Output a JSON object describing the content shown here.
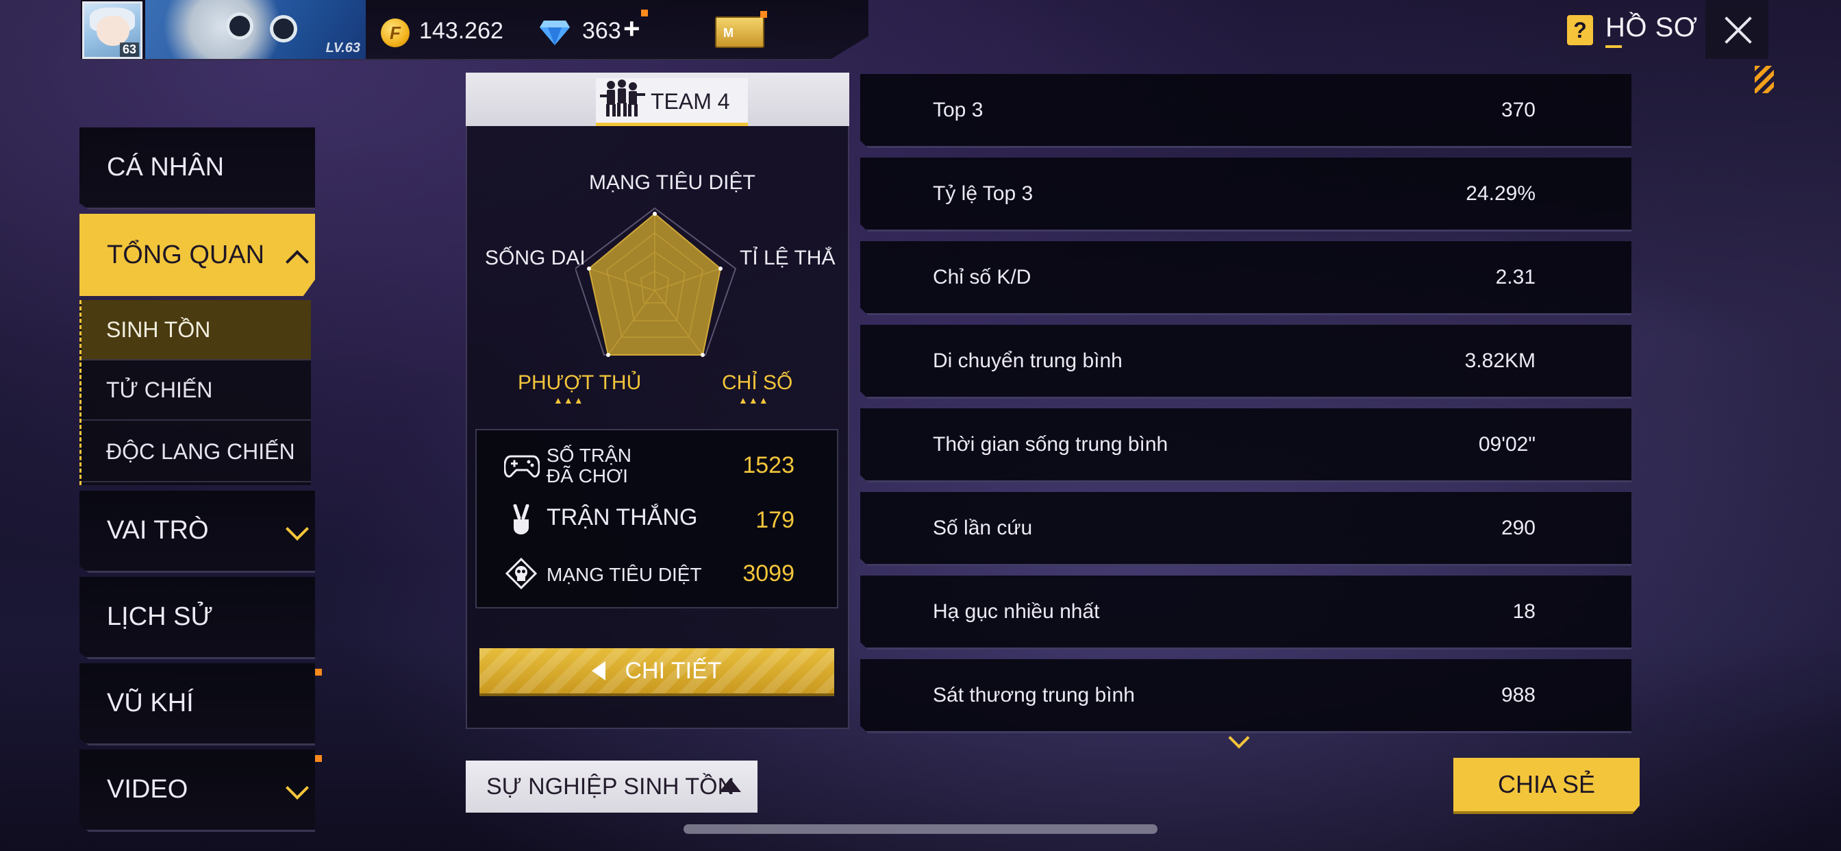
{
  "topbar": {
    "avatar_level": "63",
    "banner_level": "LV.63",
    "gold_value": "143.262",
    "diamond_value": "363",
    "diamond_plus": "+",
    "membership_label": "M",
    "page_title": "HỒ SƠ"
  },
  "sidebar": {
    "items": [
      {
        "label": "CÁ NHÂN"
      },
      {
        "label": "TỔNG QUAN"
      },
      {
        "label": "VAI TRÒ"
      },
      {
        "label": "LỊCH SỬ"
      },
      {
        "label": "VŨ KHÍ"
      },
      {
        "label": "VIDEO"
      }
    ],
    "sub_items": [
      {
        "label": "SINH TỒN"
      },
      {
        "label": "TỬ CHIẾN"
      },
      {
        "label": "ĐỘC LANG CHIẾN"
      }
    ]
  },
  "panel": {
    "team_label": "TEAM 4",
    "radar": {
      "labels": {
        "top": "MẠNG TIÊU DIỆT",
        "right": "TỈ LỆ THẮNG",
        "left": "SỐNG DAI",
        "bottom_left": "PHƯỢT THỦ",
        "bottom_right": "CHỈ SỐ"
      }
    },
    "stats": [
      {
        "label": "SỐ TRẬN ĐÃ CHƠI",
        "value": "1523"
      },
      {
        "label": "TRẬN THẮNG",
        "value": "179"
      },
      {
        "label": "MẠNG TIÊU DIỆT",
        "value": "3099"
      }
    ],
    "detail_button": "CHI TIẾT",
    "career_button": "SỰ NGHIỆP SINH TỒN"
  },
  "rows": [
    {
      "label": "Top 3",
      "value": "370"
    },
    {
      "label": "Tỷ lệ Top 3",
      "value": "24.29%"
    },
    {
      "label": "Chỉ số K/D",
      "value": "2.31"
    },
    {
      "label": "Di chuyển trung bình",
      "value": "3.82KM"
    },
    {
      "label": "Thời gian sống trung bình",
      "value": "09'02\""
    },
    {
      "label": "Số lần cứu",
      "value": "290"
    },
    {
      "label": "Hạ gục nhiều nhất",
      "value": "18"
    },
    {
      "label": "Sát thương trung bình",
      "value": "988"
    }
  ],
  "share_button": "CHIA SẺ",
  "colors": {
    "accent": "#f3c53b",
    "notification": "#ff8a1c"
  },
  "icons": [
    "gold-coin-icon",
    "diamond-icon",
    "membership-icon",
    "help-icon",
    "close-icon",
    "team-icon",
    "gamepad-icon",
    "victory-hand-icon",
    "skull-icon"
  ]
}
